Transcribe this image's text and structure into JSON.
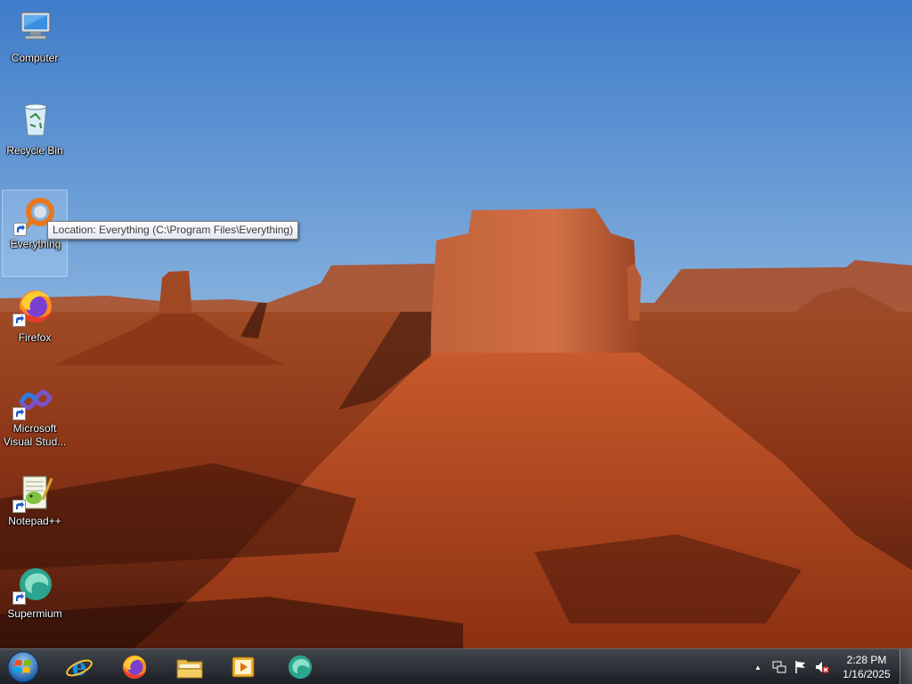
{
  "desktop": {
    "icons": [
      {
        "label": "Computer",
        "icon": "computer-icon"
      },
      {
        "label": "Recycle Bin",
        "icon": "recycle-bin-icon"
      },
      {
        "label": "Everything",
        "icon": "everything-icon",
        "shortcut": true,
        "selected": true
      },
      {
        "label": "Firefox",
        "icon": "firefox-icon",
        "shortcut": true
      },
      {
        "label": "Microsoft Visual Stud...",
        "icon": "visual-studio-icon",
        "shortcut": true
      },
      {
        "label": "Notepad++",
        "icon": "notepadpp-icon",
        "shortcut": true
      },
      {
        "label": "Supermium",
        "icon": "supermium-icon",
        "shortcut": true
      }
    ],
    "tooltip": "Location: Everything (C:\\Program Files\\Everything)"
  },
  "taskbar": {
    "start_icon": "windows-start-icon",
    "pinned": [
      {
        "icon": "internet-explorer-icon"
      },
      {
        "icon": "firefox-icon"
      },
      {
        "icon": "file-explorer-icon"
      },
      {
        "icon": "media-player-icon"
      },
      {
        "icon": "supermium-icon"
      }
    ],
    "tray": {
      "show_hidden": "▲",
      "icons": [
        "network-icon",
        "action-center-flag-icon",
        "volume-muted-icon"
      ]
    },
    "clock": {
      "time": "2:28 PM",
      "date": "1/16/2025"
    }
  },
  "colors": {
    "sky_top": "#3b78c8",
    "sky_bottom": "#b9d3e8",
    "rock": "#b5512a",
    "ground": "#6e2a12"
  }
}
